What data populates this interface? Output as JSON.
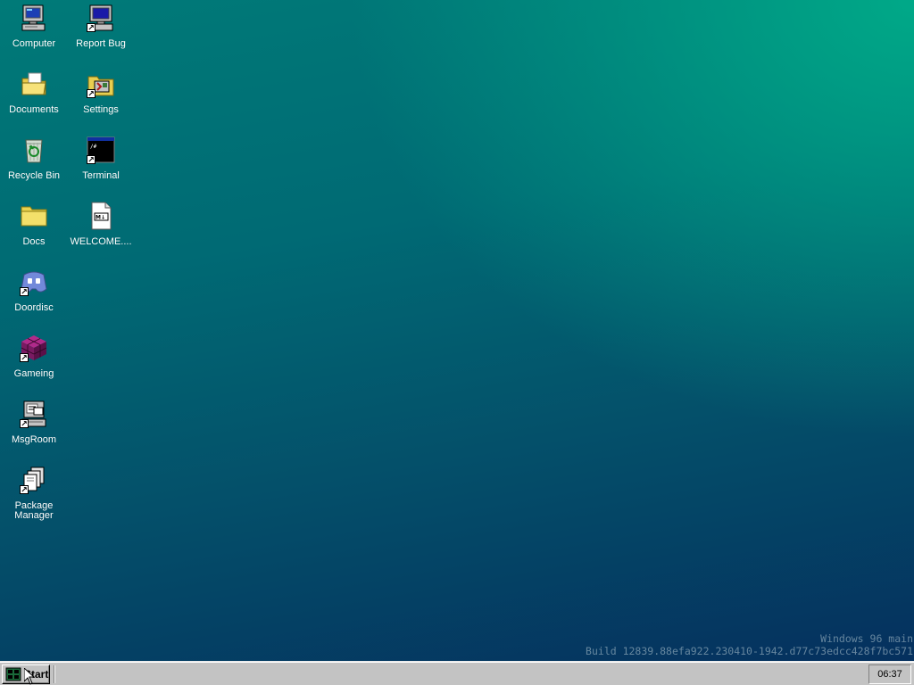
{
  "desktop": {
    "icons": [
      {
        "label": "Computer",
        "icon": "computer-icon",
        "shortcut": false
      },
      {
        "label": "Report Bug",
        "icon": "report-bug-icon",
        "shortcut": true
      },
      {
        "label": "Documents",
        "icon": "documents-folder-icon",
        "shortcut": false
      },
      {
        "label": "Settings",
        "icon": "settings-icon",
        "shortcut": true
      },
      {
        "label": "Recycle Bin",
        "icon": "recycle-bin-icon",
        "shortcut": false
      },
      {
        "label": "Terminal",
        "icon": "terminal-icon",
        "shortcut": true
      },
      {
        "label": "Docs",
        "icon": "folder-icon",
        "shortcut": false
      },
      {
        "label": "WELCOME....",
        "icon": "markdown-file-icon",
        "shortcut": false
      },
      {
        "label": "Doordisc",
        "icon": "doordisc-icon",
        "shortcut": true
      },
      {
        "label": "Gameing",
        "icon": "gameing-cube-icon",
        "shortcut": true
      },
      {
        "label": "MsgRoom",
        "icon": "msgroom-icon",
        "shortcut": true
      },
      {
        "label": "Package Manager",
        "icon": "package-manager-icon",
        "shortcut": true
      }
    ],
    "watermark": {
      "line1": "Windows 96 main",
      "line2": "Build 12839.88efa922.230410-1942.d77c73edcc428f7bc571"
    },
    "colors": {
      "top_right": "#00a988",
      "bottom_left": "#05305e"
    }
  },
  "taskbar": {
    "start_label": "Start",
    "clock": "06:37"
  }
}
